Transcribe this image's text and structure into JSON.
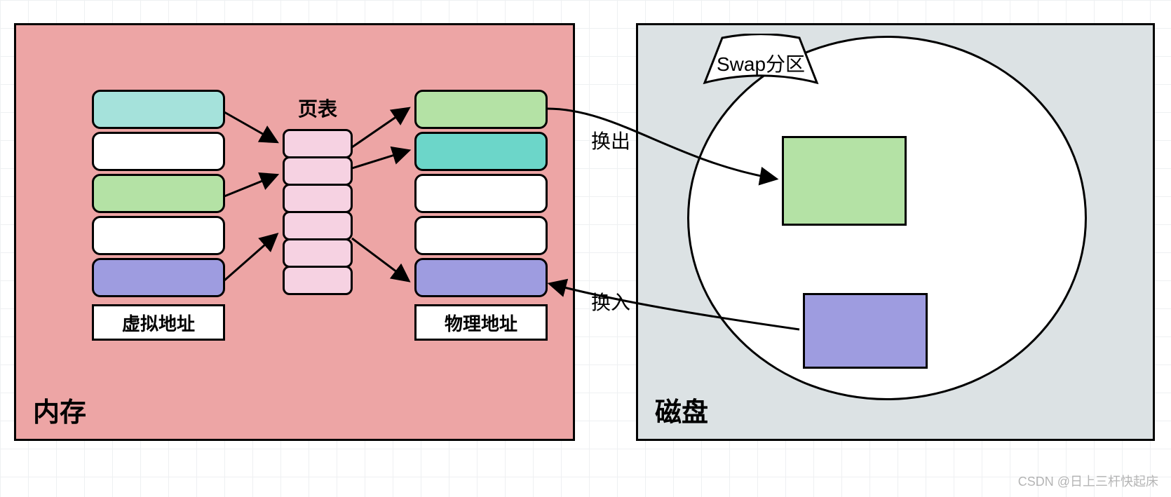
{
  "memory": {
    "title": "内存",
    "page_table_title": "页表",
    "virtual_label": "虚拟地址",
    "physical_label": "物理地址",
    "virtual_slots": [
      {
        "color": "teal"
      },
      {
        "color": "white"
      },
      {
        "color": "green"
      },
      {
        "color": "white"
      },
      {
        "color": "purple"
      }
    ],
    "page_table_entries": 6,
    "physical_slots": [
      {
        "color": "green"
      },
      {
        "color": "dteal"
      },
      {
        "color": "white"
      },
      {
        "color": "white"
      },
      {
        "color": "purple"
      }
    ]
  },
  "disk": {
    "title": "磁盘",
    "swap_label": "Swap分区",
    "blocks": [
      {
        "color": "green"
      },
      {
        "color": "purple"
      }
    ]
  },
  "arrows": {
    "swap_out": "换出",
    "swap_in": "换入"
  },
  "watermark": "CSDN @日上三杆快起床"
}
